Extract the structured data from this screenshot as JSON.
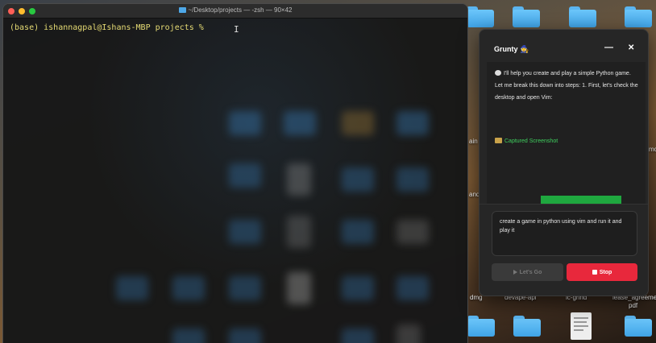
{
  "terminal": {
    "title": "~/Desktop/projects — -zsh — 90×42",
    "prompt": "(base) ishannagpal@Ishans-MBP projects %",
    "cursor": "I"
  },
  "grunty": {
    "title": "Grunty 🧙",
    "minimize": "—",
    "close": "✕",
    "message": "I'll help you create and play a simple Python game. Let me break this down into steps: 1. First, let's check the desktop and open Vim:",
    "screenshot_label": "Captured Screenshot",
    "input_value": "create a game in python using vim and run it and play it",
    "lets_go_label": "Let's Go",
    "stop_label": "Stop",
    "colors": {
      "stop": "#e8283c",
      "progress": "#1fa83f",
      "screenshot": "#3fcf5e"
    }
  },
  "desktop": {
    "labels": {
      "dmg": "dmg",
      "devape": "devape-api",
      "lcgrind": "lc-grind",
      "lease": "lease_agreeme",
      "pdf": "pdf",
      "ain": "ain",
      "and": "and",
      "mc": "mc"
    }
  }
}
